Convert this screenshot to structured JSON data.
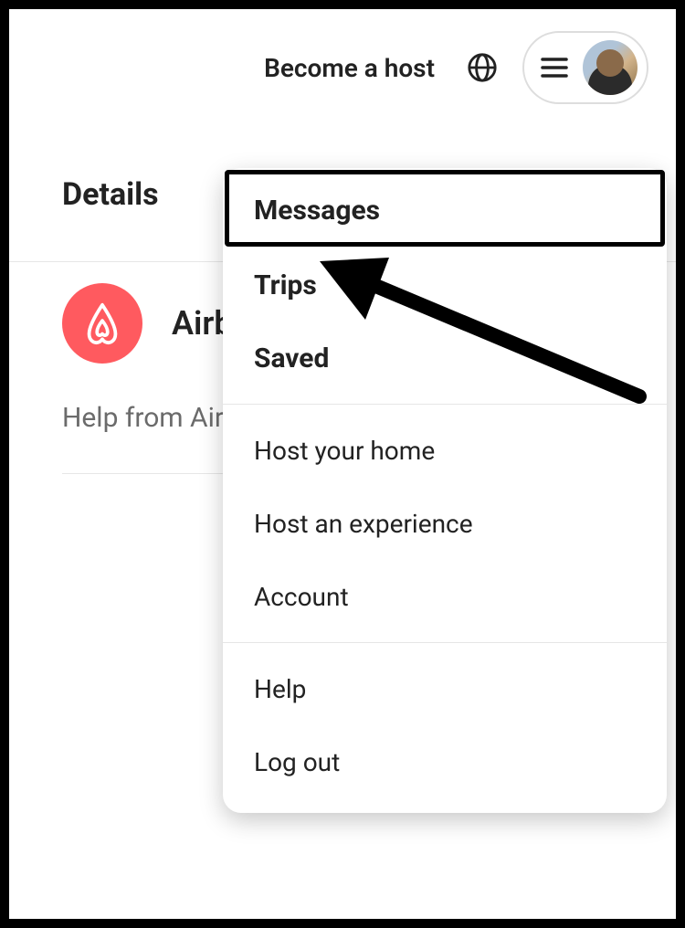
{
  "topbar": {
    "become_host_label": "Become a host"
  },
  "details": {
    "label": "Details"
  },
  "support": {
    "brand_partial": "Airb",
    "help_partial": "Help from Air"
  },
  "menu": {
    "items": [
      {
        "label": "Messages",
        "bold": true
      },
      {
        "label": "Trips",
        "bold": true
      },
      {
        "label": "Saved",
        "bold": true
      }
    ],
    "items2": [
      {
        "label": "Host your home"
      },
      {
        "label": "Host an experience"
      },
      {
        "label": "Account"
      }
    ],
    "items3": [
      {
        "label": "Help"
      },
      {
        "label": "Log out"
      }
    ]
  }
}
